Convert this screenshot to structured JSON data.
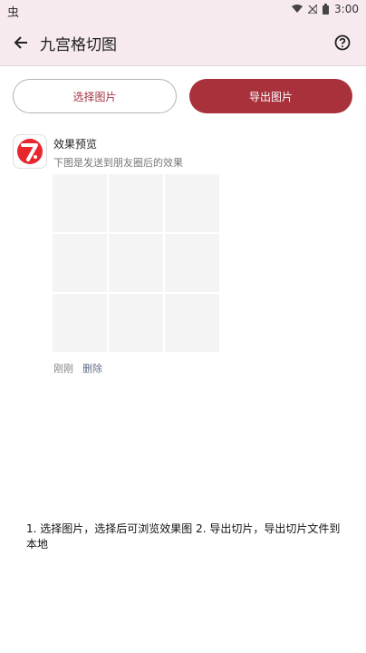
{
  "status_bar": {
    "left_glyph": "虫",
    "time": "3:00",
    "icons": [
      "wifi-icon",
      "signal-icon",
      "battery-icon"
    ]
  },
  "app_bar": {
    "title": "九宫格切图",
    "back_icon": "arrow-left-icon",
    "help_icon": "help-circle-icon"
  },
  "actions": {
    "select_label": "选择图片",
    "export_label": "导出图片"
  },
  "preview": {
    "title": "效果预览",
    "subtitle": "下图是发送到朋友圈后的效果",
    "grid_cells": 9,
    "time_label": "刚刚",
    "delete_label": "删除"
  },
  "instructions": "1. 选择图片，选择后可浏览效果图 2. 导出切片，导出切片文件到本地",
  "colors": {
    "accent": "#a8313c",
    "header_bg": "#f6eaee",
    "cell_bg": "#f4f4f4"
  }
}
